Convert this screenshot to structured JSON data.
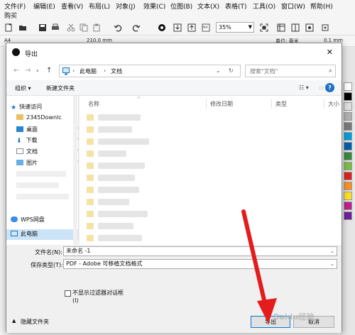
{
  "menubar": {
    "items": [
      "文件(F)",
      "编辑(E)",
      "查看(V)",
      "布局(L)",
      "对象(J)",
      "效果(C)",
      "位图(B)",
      "文本(X)",
      "表格(T)",
      "工具(O)",
      "窗口(W)",
      "帮助(H)"
    ],
    "second_row": "购买"
  },
  "toolbar": {
    "zoom": "35%",
    "icons": [
      "new-icon",
      "open-icon",
      "save-icon",
      "print-icon",
      "cut-icon",
      "copy-icon",
      "paste-icon",
      "undo-icon",
      "redo-icon",
      "search-icon",
      "import-icon",
      "export-icon",
      "pdf-icon",
      "fullscreen-icon"
    ]
  },
  "propbar": {
    "page_size": "A4",
    "width": "210.0 mm",
    "units": "单位: 毫米",
    "nudge": "0.1 mm"
  },
  "palette": [
    "#ffffff",
    "#000000",
    "#e0e0e0",
    "#b0b0b0",
    "#7a7a7a",
    "#00a0e0",
    "#0060b0",
    "#3a8a3a",
    "#7ac040",
    "#e02020",
    "#ff9020",
    "#ffe020",
    "#c02090",
    "#7020a0"
  ],
  "dialog": {
    "title": "导出",
    "breadcrumb": [
      "此电脑",
      "文档"
    ],
    "search_placeholder": "搜索\"文档\"",
    "commands": {
      "organize": "组织 ▾",
      "new_folder": "新建文件夹"
    },
    "nav": [
      {
        "label": "快速访问",
        "icon": "star-icon"
      },
      {
        "label": "2345Downlc",
        "icon": "folder-icon"
      },
      {
        "label": "桌面",
        "icon": "desktop-icon"
      },
      {
        "label": "下载",
        "icon": "download-icon"
      },
      {
        "label": "文档",
        "icon": "document-icon"
      },
      {
        "label": "图片",
        "icon": "picture-icon"
      },
      {
        "label": "WPS网盘",
        "icon": "cloud-icon"
      },
      {
        "label": "此电脑",
        "icon": "computer-icon"
      }
    ],
    "columns": [
      "名称",
      "修改日期",
      "类型",
      "大小"
    ],
    "filename_label": "文件名(N):",
    "filename_value": "未命名 -1",
    "filetype_label": "保存类型(T):",
    "filetype_value": "PDF - Adobe 可移植文档格式",
    "checkbox_label": "不显示过滤器对话框",
    "checkbox_sub": "(I)",
    "hide_folders": "隐藏文件夹",
    "export_button": "导出",
    "cancel_button": "取消"
  },
  "watermark": "Baidu经验"
}
